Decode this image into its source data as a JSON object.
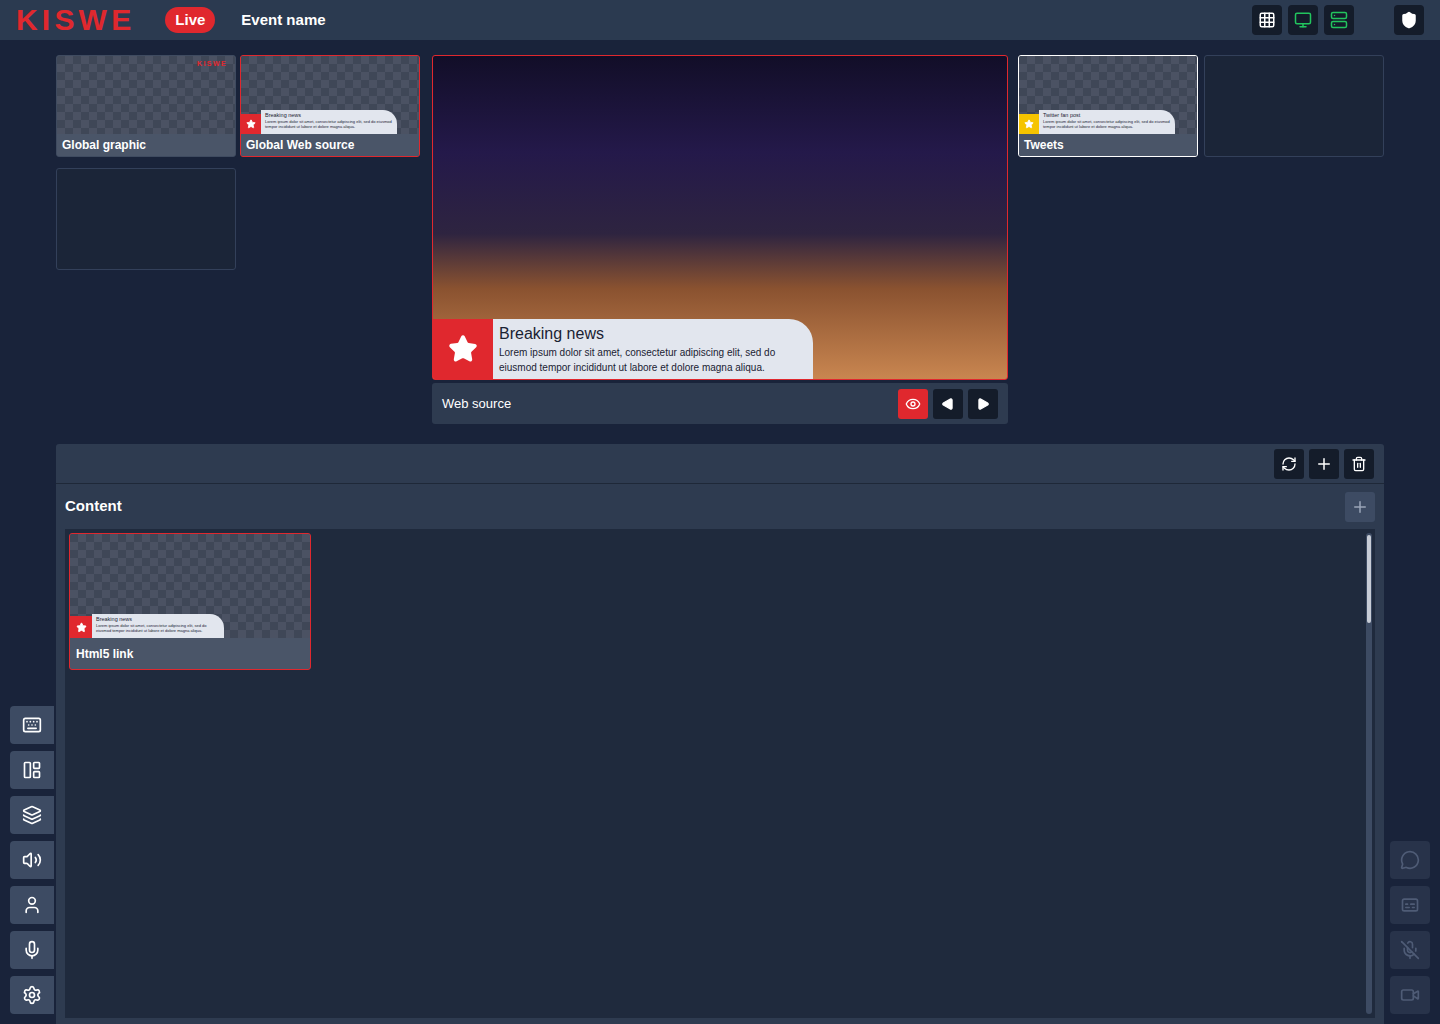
{
  "header": {
    "logo": "KISWE",
    "status": "Live",
    "event_name": "Event name",
    "tools": [
      {
        "active": false
      },
      {
        "active": true
      },
      {
        "active": true
      },
      {
        "active": false
      }
    ]
  },
  "sources_left": [
    {
      "kind": "logo",
      "label": "Global graphic",
      "logo": "KISWE",
      "on_air": false,
      "selected": false
    },
    {
      "kind": "lower-third",
      "label": "Global Web source",
      "title": "Breaking news",
      "body": "Lorem ipsum dolor sit amet, consectetur adipiscing elit, sed do eiusmod tempor incididunt ut labore et dolore magna aliqua.",
      "color": "#e0282e",
      "on_air": true,
      "selected": false
    },
    {
      "kind": "empty"
    }
  ],
  "program": {
    "title": "Breaking news",
    "body": "Lorem ipsum dolor sit amet, consectetur adipiscing elit, sed do eiusmod tempor incididunt ut labore et dolore magna aliqua.",
    "color": "#e0282e",
    "source": "Web source",
    "visible": true
  },
  "sources_right": [
    {
      "kind": "lower-third",
      "label": "Tweets",
      "title": "Twitter fan post",
      "body": "Lorem ipsum dolor sit amet, consectetur adipiscing elit, sed do eiusmod tempor incididunt ut labore et dolore magna aliqua.",
      "color": "#f5c400",
      "on_air": false,
      "selected": true
    },
    {
      "kind": "empty"
    }
  ],
  "panel": {
    "title": "Content",
    "items": [
      {
        "label": "Html5 link",
        "title": "Breaking news",
        "body": "Lorem ipsum dolor sit amet, consectetur adipiscing elit, sed do eiusmod tempor incididunt ut labore et dolore magna aliqua.",
        "color": "#e0282e",
        "on_air": true
      }
    ]
  },
  "left_nav": [
    {
      "disabled": false
    },
    {
      "disabled": false
    },
    {
      "disabled": false
    },
    {
      "disabled": false
    },
    {
      "disabled": false
    },
    {
      "disabled": false
    },
    {
      "disabled": false
    }
  ],
  "right_nav": [
    {
      "disabled": true
    },
    {
      "disabled": true
    },
    {
      "disabled": true
    },
    {
      "disabled": true
    }
  ]
}
